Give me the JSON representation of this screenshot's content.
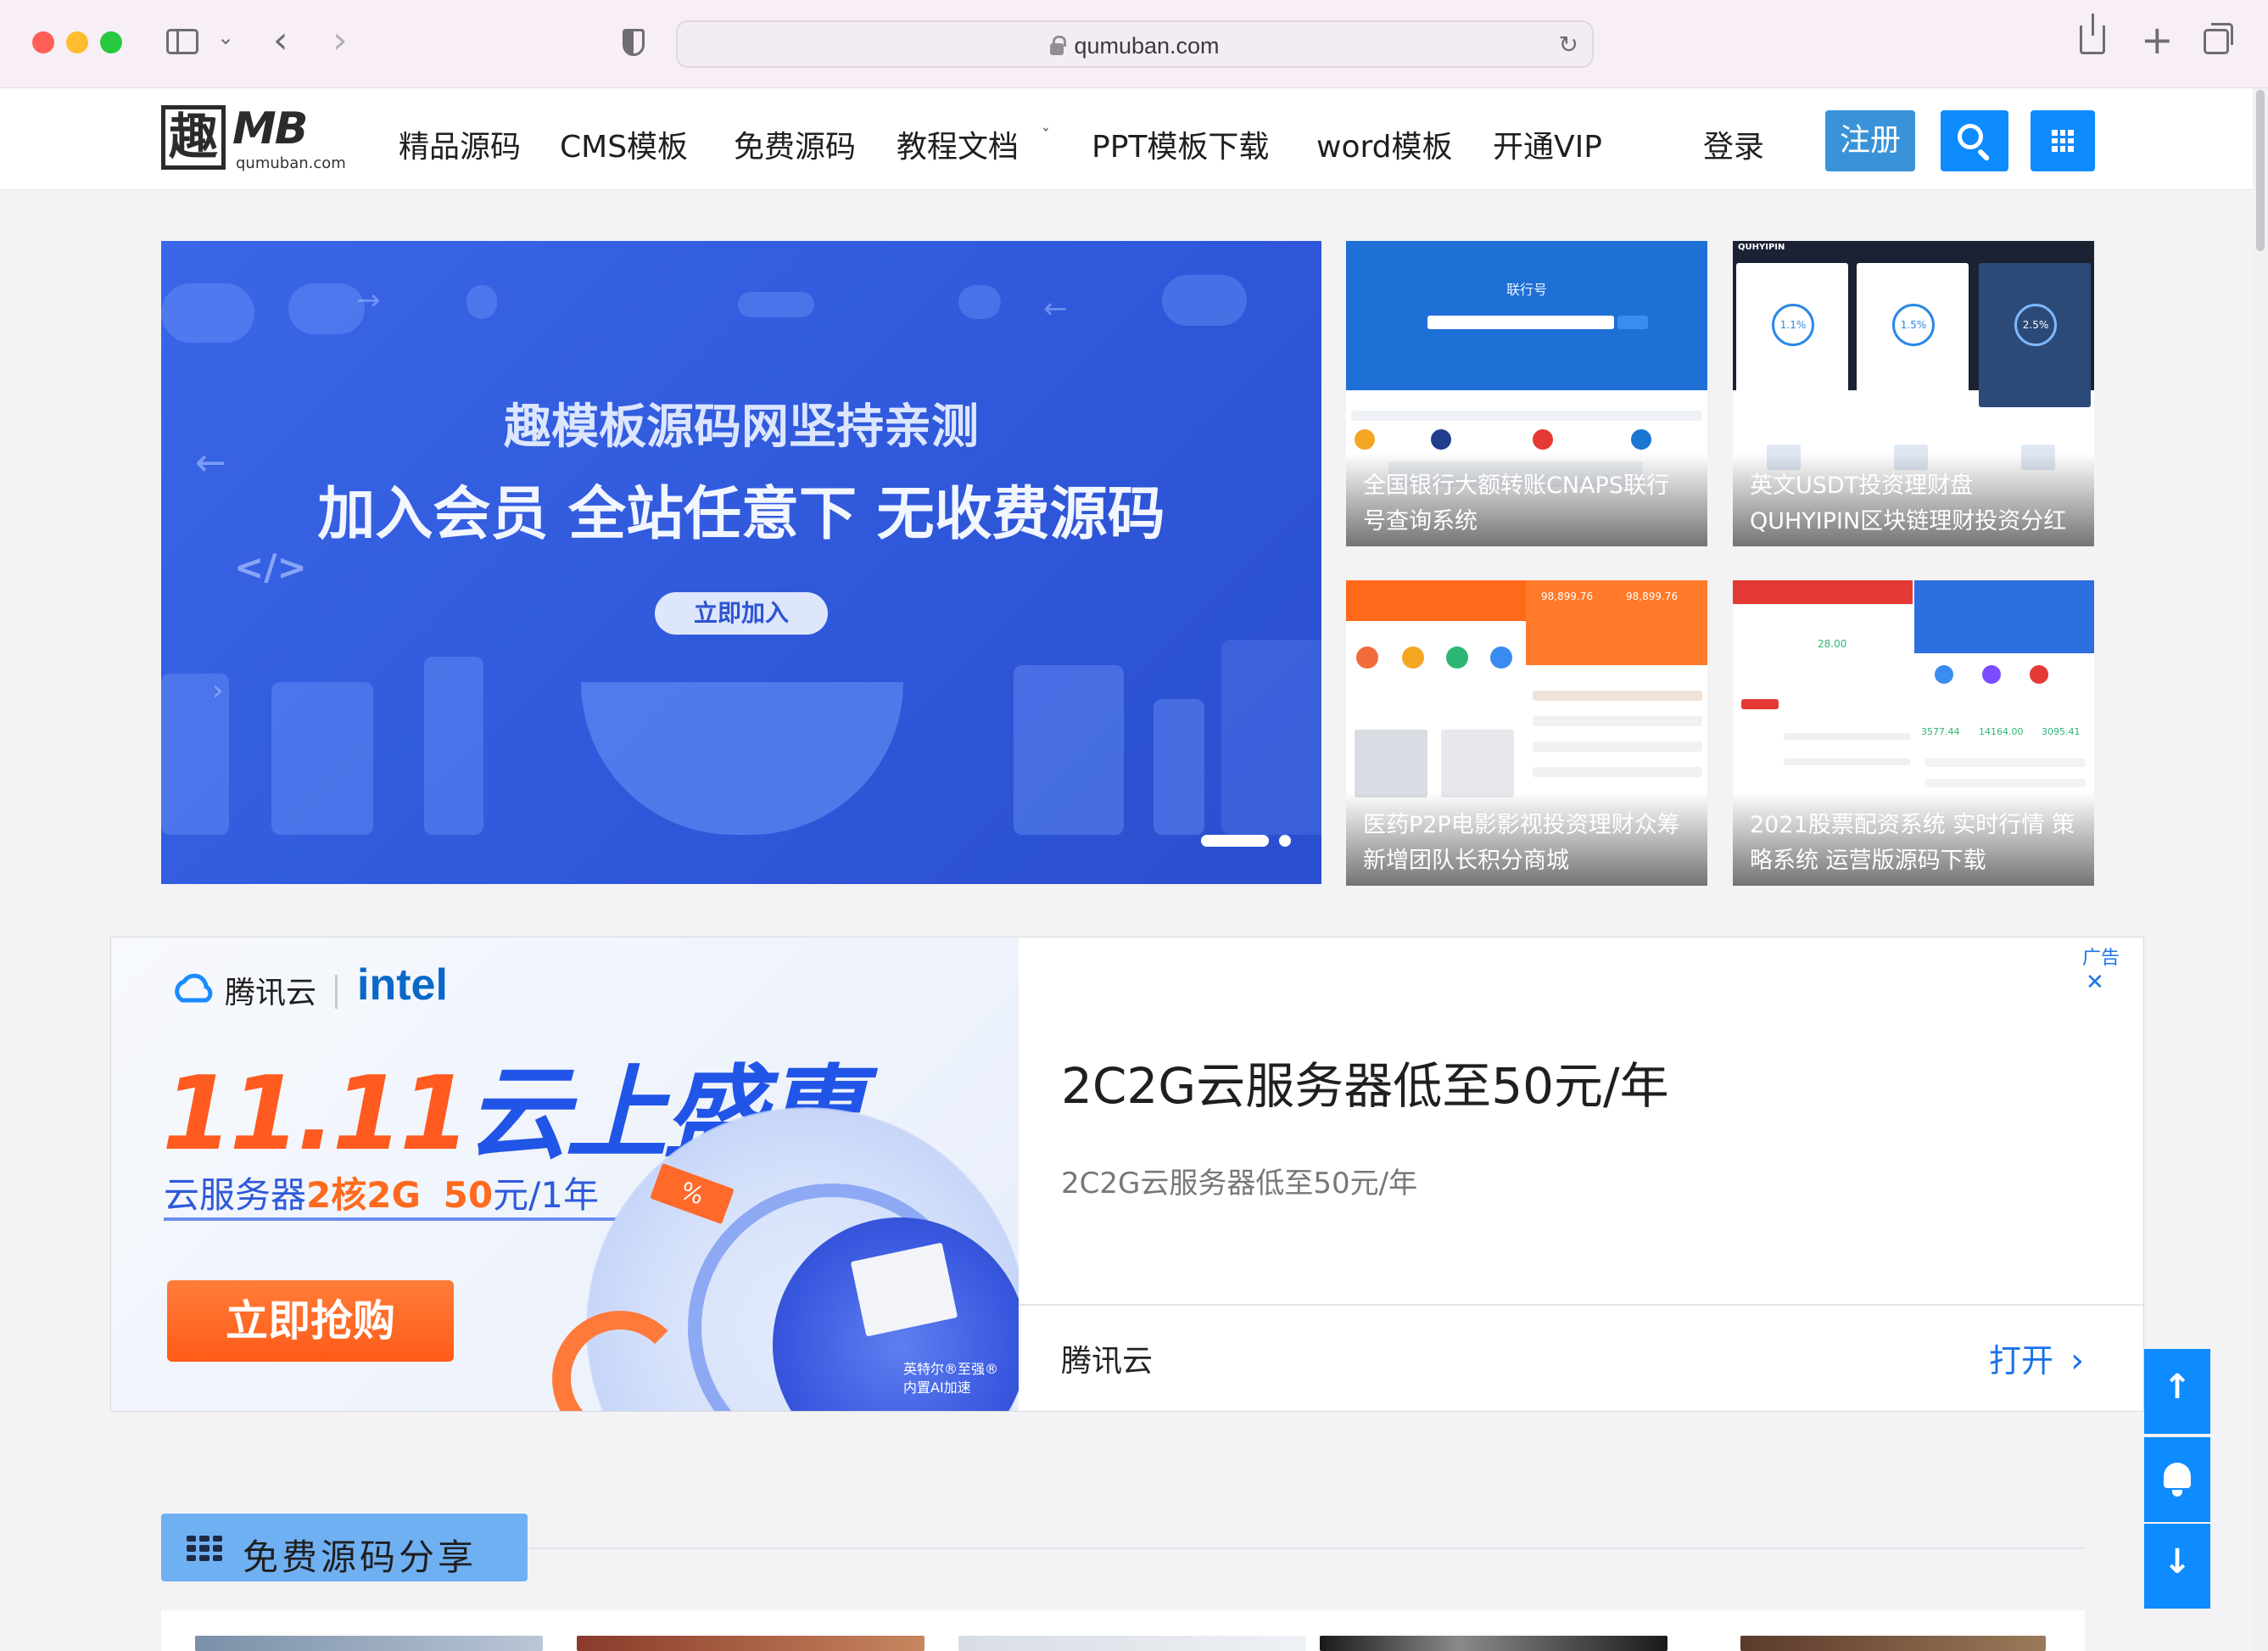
{
  "browser": {
    "url": "qumuban.com"
  },
  "site": {
    "logo_mark": "趣",
    "logo_text": "MB",
    "logo_domain": "qumuban.com",
    "nav": [
      {
        "label": "精品源码"
      },
      {
        "label": "CMS模板"
      },
      {
        "label": "免费源码"
      },
      {
        "label": "教程文档"
      },
      {
        "label": "PPT模板下载"
      },
      {
        "label": "word模板"
      },
      {
        "label": "开通VIP"
      }
    ],
    "login_label": "登录",
    "register_label": "注册"
  },
  "hero": {
    "line1": "趣模板源码网坚持亲测",
    "line2": "加入会员 全站任意下 无收费源码",
    "button_label": "立即加入"
  },
  "thumbs": [
    {
      "caption": "全国银行大额转账CNAPS联行号查询系统",
      "mock_title": "联行号"
    },
    {
      "caption": "英文USDT投资理财盘QUHYIPIN区块链理财投资分红",
      "mock_brand": "QUHYIPIN",
      "mock_rates": [
        "1.1%",
        "1.5%",
        "2.5%"
      ]
    },
    {
      "caption": "医药P2P电影影视投资理财众筹新增团队长积分商城",
      "mock_values": [
        "98,899.76",
        "98,899.76"
      ]
    },
    {
      "caption": "2021股票配资系统 实时行情 策略系统 运营版源码下载",
      "mock_values": [
        "28.00",
        "3577.44",
        "14164.00",
        "3095.41"
      ]
    }
  ],
  "ad": {
    "label": "广告",
    "brand": "腾讯云",
    "partner": "intel",
    "promo_num": "11.11",
    "promo_text": "云上盛惠",
    "line_prefix": "云服务器",
    "line_spec": "2核2G",
    "line_price": "50",
    "line_suffix": "元/1年",
    "buy_label": "立即抢购",
    "chip_text_1": "英特尔®至强®",
    "chip_text_2": "内置AI加速",
    "title": "2C2G云服务器低至50元/年",
    "description": "2C2G云服务器低至50元/年",
    "advertiser": "腾讯云",
    "open_label": "打开"
  },
  "section": {
    "title": "免费源码分享"
  },
  "colors": {
    "primary": "#0d8bff",
    "register": "#3a93d8",
    "hero_blue": "#2f57d9",
    "ad_orange": "#ff5a1f",
    "section_tag": "#6fb0f3"
  },
  "icons": [
    "sidebar-icon",
    "back-icon",
    "forward-icon",
    "shield-icon",
    "reload-icon",
    "share-icon",
    "new-tab-icon",
    "tabs-icon",
    "search-icon",
    "grid-icon",
    "arrow-up-icon",
    "bell-icon",
    "arrow-down-icon",
    "close-icon",
    "chevron-right-icon"
  ]
}
